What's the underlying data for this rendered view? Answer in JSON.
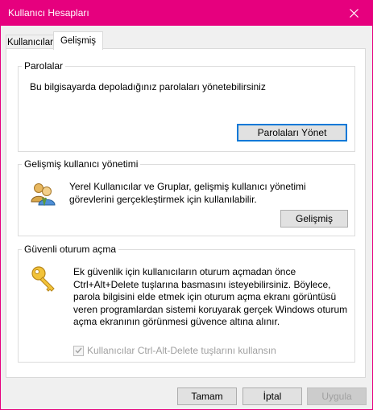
{
  "window": {
    "title": "Kullanıcı Hesapları",
    "accent_color": "#e6007e",
    "close_icon": "close-icon"
  },
  "tabs": [
    {
      "label": "Kullanıcılar",
      "active": false
    },
    {
      "label": "Gelişmiş",
      "active": true
    }
  ],
  "passwords": {
    "heading": "Parolalar",
    "description": "Bu bilgisayarda depoladığınız parolaları yönetebilirsiniz",
    "button_label": "Parolaları Yönet"
  },
  "advanced_user_management": {
    "heading": "Gelişmiş kullanıcı yönetimi",
    "description_line1": "Yerel Kullanıcılar ve Gruplar, gelişmiş kullanıcı yönetimi",
    "description_line2": "görevlerini gerçekleştirmek için kullanılabilir.",
    "button_label": "Gelişmiş",
    "icon": "users-icon"
  },
  "secure_logon": {
    "heading": "Güvenli oturum açma",
    "description_lines": [
      "Ek güvenlik için kullanıcıların oturum açmadan önce",
      "Ctrl+Alt+Delete tuşlarına basmasını isteyebilirsiniz. Böylece,",
      "parola bilgisini elde etmek için oturum açma ekranı görüntüsü",
      "veren programlardan sistemi koruyarak gerçek Windows oturum",
      "açma ekranının görünmesi güvence altına alınır."
    ],
    "checkbox_label": "Kullanıcılar Ctrl-Alt-Delete tuşlarını kullansın",
    "checkbox_checked": true,
    "checkbox_enabled": false,
    "icon": "key-icon"
  },
  "footer": {
    "ok_label": "Tamam",
    "cancel_label": "İptal",
    "apply_label": "Uygula"
  }
}
